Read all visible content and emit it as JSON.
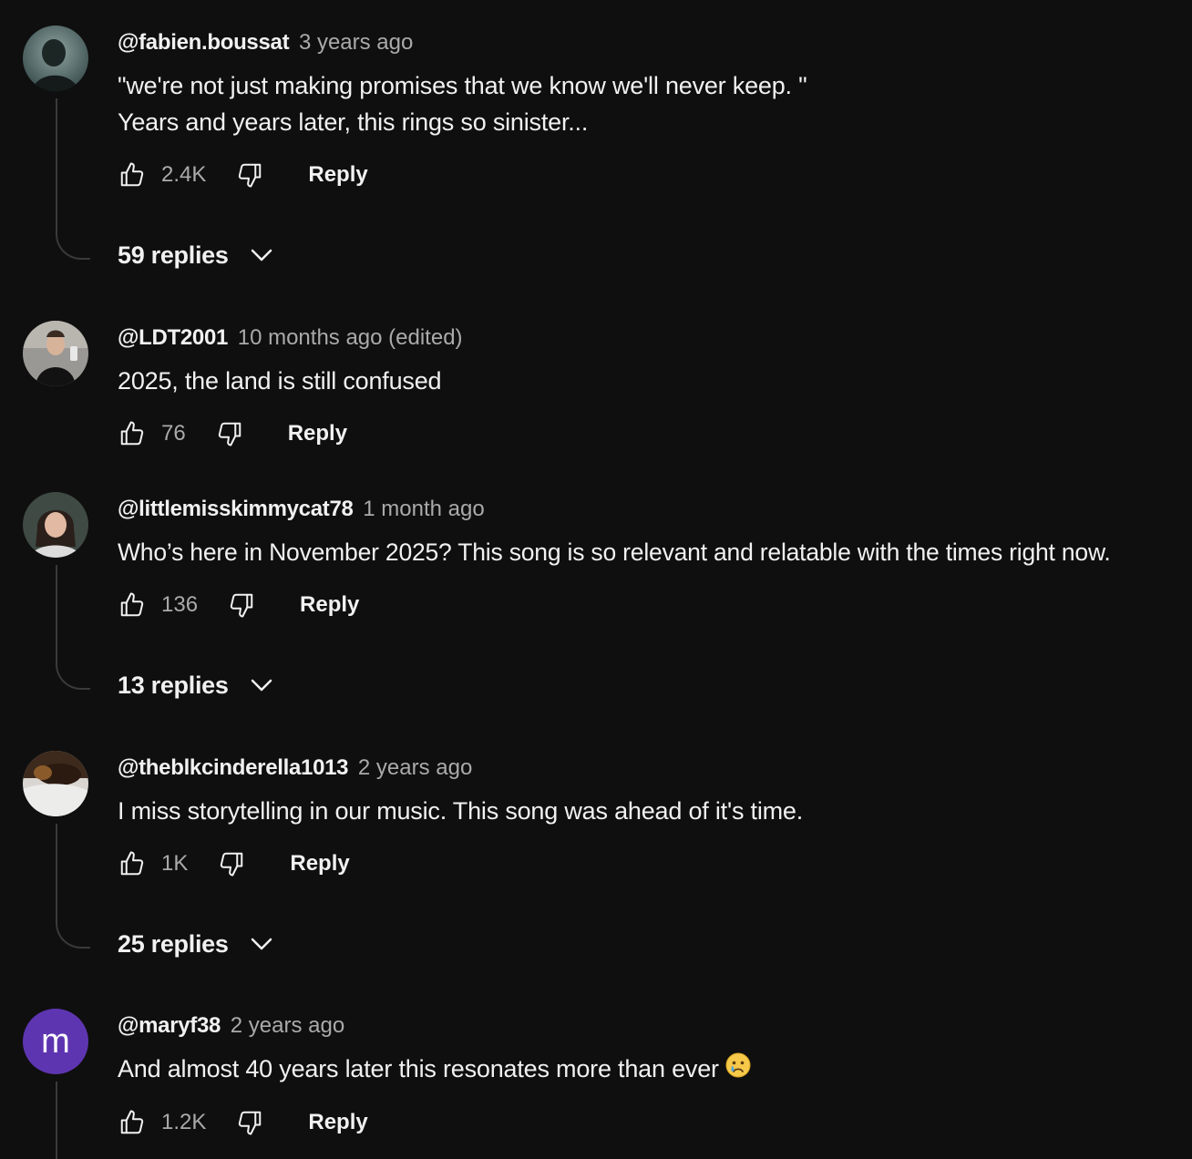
{
  "colors": {
    "background": "#0f0f0f",
    "text_primary": "#f1f1f1",
    "text_secondary": "#aaaaaa",
    "thread_line": "#3a3a3a",
    "letter_avatar_bg": "#5e35b1"
  },
  "icons": {
    "like": "thumbs-up-outline-icon",
    "dislike": "thumbs-down-outline-icon",
    "expand": "chevron-down-icon",
    "emoji": "crying-face-emoji"
  },
  "comments": [
    {
      "author": "@fabien.boussat",
      "meta": "3 years ago",
      "line1": "\"we're not just making promises that we know we'll never keep. \"",
      "line2": "Years and years later, this rings so sinister...",
      "likes": "2.4K",
      "reply_label": "Reply",
      "replies_label": "59 replies"
    },
    {
      "author": "@LDT2001",
      "meta": "10 months ago (edited)",
      "line1": "2025, the land is still confused",
      "likes": "76",
      "reply_label": "Reply"
    },
    {
      "author": "@littlemisskimmycat78",
      "meta": "1 month ago",
      "line1": "Who’s here in November 2025? This song is so relevant and relatable with the times right now.",
      "likes": "136",
      "reply_label": "Reply",
      "replies_label": "13 replies"
    },
    {
      "author": "@theblkcinderella1013",
      "meta": "2 years ago",
      "line1": "I miss storytelling in our music. This song was ahead of it's time.",
      "likes": "1K",
      "reply_label": "Reply",
      "replies_label": "25 replies"
    },
    {
      "author": "@maryf38",
      "avatar_letter": "m",
      "meta": "2 years ago",
      "line1": "And almost 40 years later this resonates more than ever",
      "likes": "1.2K",
      "reply_label": "Reply"
    }
  ]
}
